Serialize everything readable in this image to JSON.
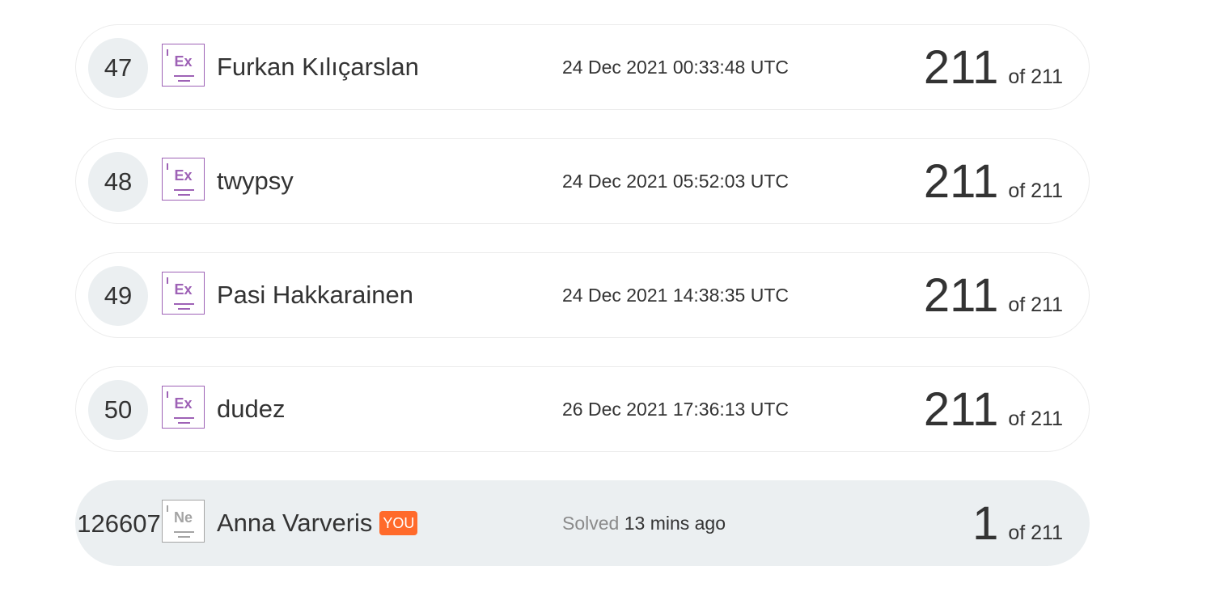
{
  "rows": [
    {
      "rank": "47",
      "level_abbr": "Ex",
      "name": "Furkan Kılıçarslan",
      "solved_at": "24 Dec 2021 00:33:48 UTC",
      "score": "211",
      "of_total": "of 211"
    },
    {
      "rank": "48",
      "level_abbr": "Ex",
      "name": "twypsy",
      "solved_at": "24 Dec 2021 05:52:03 UTC",
      "score": "211",
      "of_total": "of 211"
    },
    {
      "rank": "49",
      "level_abbr": "Ex",
      "name": "Pasi Hakkarainen",
      "solved_at": "24 Dec 2021 14:38:35 UTC",
      "score": "211",
      "of_total": "of 211"
    },
    {
      "rank": "50",
      "level_abbr": "Ex",
      "name": "dudez",
      "solved_at": "26 Dec 2021 17:36:13 UTC",
      "score": "211",
      "of_total": "of 211"
    }
  ],
  "current_user": {
    "rank": "126607",
    "level_abbr": "Ne",
    "name": "Anna Varveris",
    "you_label": "YOU",
    "solved_label": "Solved",
    "solved_ago": "13 mins ago",
    "score": "1",
    "of_total": "of 211"
  },
  "colors": {
    "expert_badge": "#9e62b6",
    "novice_badge": "#a4a4a4",
    "you_badge": "#ff6a2b",
    "rank_circle": "#ebeff1",
    "current_row_bg": "#ebeff1"
  }
}
